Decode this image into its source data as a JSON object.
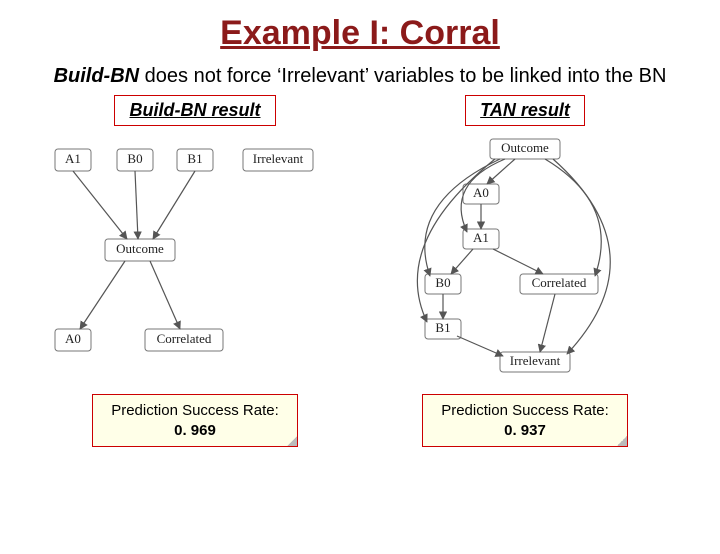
{
  "title": "Example I: Corral",
  "subtitle_method": "Build-BN",
  "subtitle_rest": " does not force ‘Irrelevant’ variables to be linked into the BN",
  "left": {
    "header": "Build-BN result",
    "result_label": "Prediction Success Rate:",
    "result_value": "0. 969",
    "nodes": {
      "a1": "A1",
      "b0": "B0",
      "b1": "B1",
      "irrelevant": "Irrelevant",
      "outcome": "Outcome",
      "a0": "A0",
      "correlated": "Correlated"
    }
  },
  "right": {
    "header": "TAN result",
    "result_label": "Prediction Success Rate:",
    "result_value": "0. 937",
    "nodes": {
      "outcome": "Outcome",
      "a0": "A0",
      "a1": "A1",
      "b0": "B0",
      "correlated": "Correlated",
      "b1": "B1",
      "irrelevant": "Irrelevant"
    }
  }
}
